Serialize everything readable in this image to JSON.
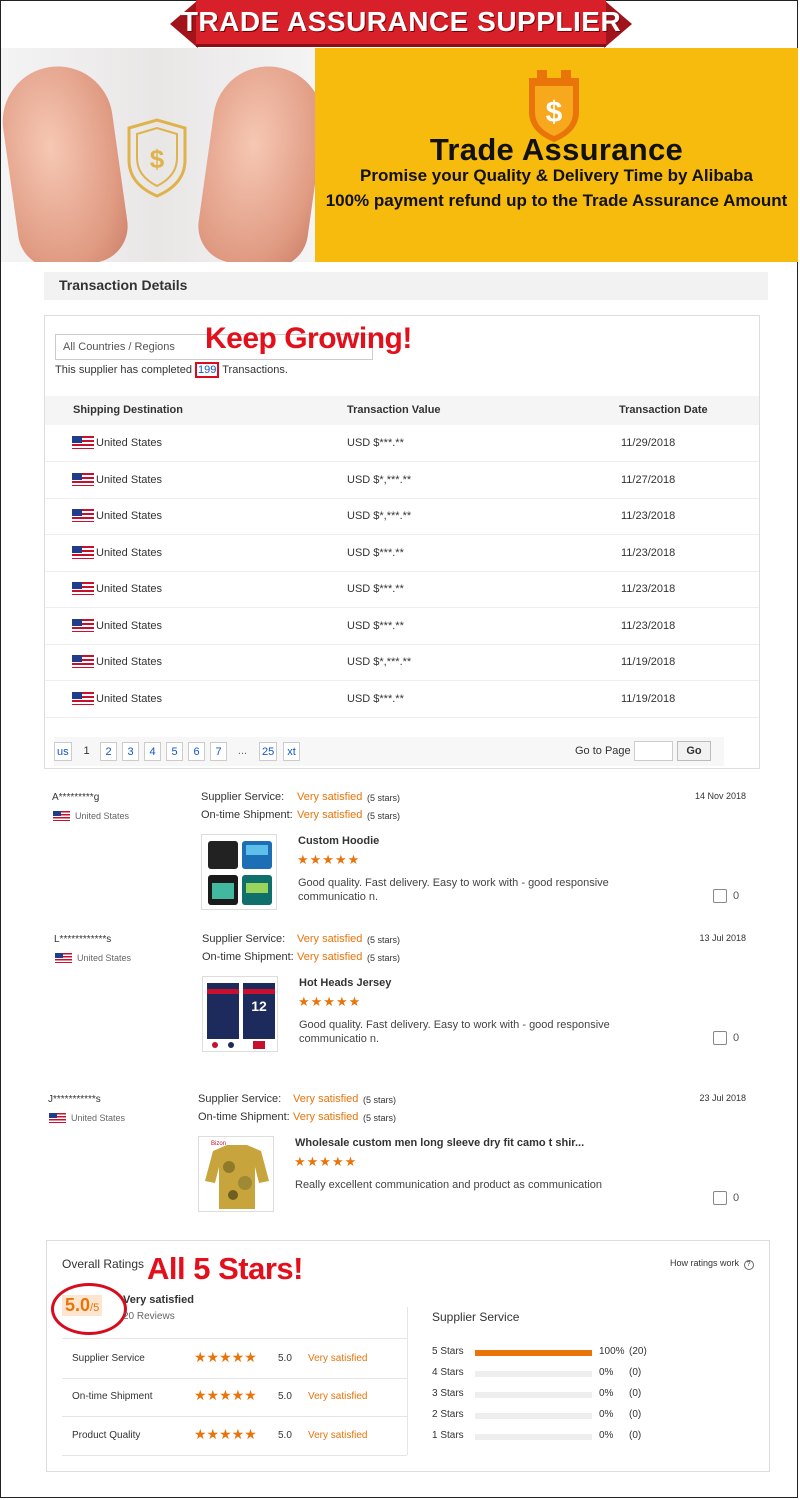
{
  "banner": {
    "ribbon": "TRADE ASSURANCE SUPPLIER",
    "title": "Trade Assurance",
    "subtitle1": "Promise your Quality & Delivery Time by Alibaba",
    "subtitle2": "100% payment refund up to the Trade Assurance Amount",
    "accent": "#f6bb0c"
  },
  "transactions": {
    "heading": "Transaction Details",
    "country_filter": "All Countries / Regions",
    "overlay": "Keep Growing!",
    "completed_prefix": "This supplier has completed",
    "completed_count": "199",
    "completed_suffix": "Transactions.",
    "columns": [
      "Shipping Destination",
      "Transaction Value",
      "Transaction Date"
    ],
    "rows": [
      {
        "dest": "United States",
        "value": "USD $***.**",
        "date": "11/29/2018"
      },
      {
        "dest": "United States",
        "value": "USD $*,***.**",
        "date": "11/27/2018"
      },
      {
        "dest": "United States",
        "value": "USD $*,***.**",
        "date": "11/23/2018"
      },
      {
        "dest": "United States",
        "value": "USD $***.**",
        "date": "11/23/2018"
      },
      {
        "dest": "United States",
        "value": "USD $***.**",
        "date": "11/23/2018"
      },
      {
        "dest": "United States",
        "value": "USD $***.**",
        "date": "11/23/2018"
      },
      {
        "dest": "United States",
        "value": "USD $*,***.**",
        "date": "11/19/2018"
      },
      {
        "dest": "United States",
        "value": "USD $***.**",
        "date": "11/19/2018"
      }
    ],
    "pager": {
      "prev": "us",
      "pages": [
        "1",
        "2",
        "3",
        "4",
        "5",
        "6",
        "7",
        "...",
        "25"
      ],
      "next": "xt",
      "goto_label": "Go to Page",
      "go": "Go"
    }
  },
  "reviews": [
    {
      "name": "A*********g",
      "country": "United States",
      "service_label": "Supplier Service:",
      "service": "Very satisfied",
      "service_stars": "(5 stars)",
      "ship_label": "On-time Shipment:",
      "ship": "Very satisfied",
      "ship_stars": "(5 stars)",
      "date": "14 Nov 2018",
      "product": "Custom Hoodie",
      "stars": "★★★★★",
      "text": "Good quality. Fast delivery. Easy to work with - good responsive communicatio n.",
      "likes": "0"
    },
    {
      "name": "L************s",
      "country": "United States",
      "service_label": "Supplier Service:",
      "service": "Very satisfied",
      "service_stars": "(5 stars)",
      "ship_label": "On-time Shipment:",
      "ship": "Very satisfied",
      "ship_stars": "(5 stars)",
      "date": "13 Jul 2018",
      "product": "Hot Heads Jersey",
      "stars": "★★★★★",
      "text": "Good quality. Fast delivery. Easy to work with - good responsive communicatio n.",
      "likes": "0"
    },
    {
      "name": "J***********s",
      "country": "United States",
      "service_label": "Supplier Service:",
      "service": "Very satisfied",
      "service_stars": "(5 stars)",
      "ship_label": "On-time Shipment:",
      "ship": "Very satisfied",
      "ship_stars": "(5 stars)",
      "date": "23 Jul 2018",
      "product": "Wholesale custom men long sleeve dry fit camo t shir...",
      "stars": "★★★★★",
      "text": "Really excellent communication and product as communication",
      "likes": "0"
    }
  ],
  "overall": {
    "title": "Overall Ratings",
    "overlay": "All 5 Stars!",
    "how": "How ratings work",
    "score": "5.0",
    "out_of": "/5",
    "summary": "Very satisfied",
    "reviews": "20 Reviews",
    "categories": [
      {
        "label": "Supplier Service",
        "stars": "★★★★★",
        "value": "5.0",
        "text": "Very satisfied"
      },
      {
        "label": "On-time Shipment",
        "stars": "★★★★★",
        "value": "5.0",
        "text": "Very satisfied"
      },
      {
        "label": "Product Quality",
        "stars": "★★★★★",
        "value": "5.0",
        "text": "Very satisfied"
      }
    ],
    "breakdown_title": "Supplier Service",
    "breakdown": [
      {
        "label": "5 Stars",
        "fraction": 1.0,
        "pct": "100%",
        "count": "(20)"
      },
      {
        "label": "4 Stars",
        "fraction": 0,
        "pct": "0%",
        "count": "(0)"
      },
      {
        "label": "3 Stars",
        "fraction": 0,
        "pct": "0%",
        "count": "(0)"
      },
      {
        "label": "2 Stars",
        "fraction": 0,
        "pct": "0%",
        "count": "(0)"
      },
      {
        "label": "1 Stars",
        "fraction": 0,
        "pct": "0%",
        "count": "(0)"
      }
    ],
    "accent": "#e8740a"
  }
}
